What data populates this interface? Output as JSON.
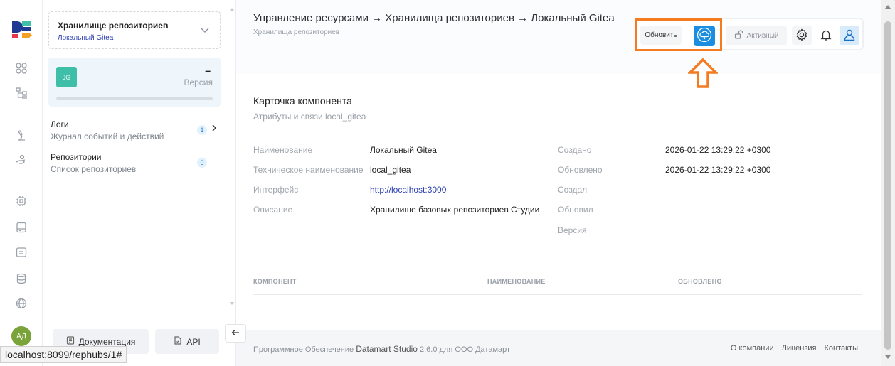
{
  "rail": {
    "avatar_initials": "АД"
  },
  "sidebar": {
    "repo_title": "Хранилище репозиториев",
    "repo_subtitle": "Локальный Gitea",
    "version_card": {
      "initials": "JG",
      "value": "–",
      "label": "Версия"
    },
    "nav": [
      {
        "title": "Логи",
        "subtitle": "Журнал событий и действий",
        "count": "1"
      },
      {
        "title": "Репозитории",
        "subtitle": "Список репозиториев",
        "count": "0"
      }
    ],
    "docs_label": "Документация",
    "api_label": "API"
  },
  "status_bar": {
    "url": "localhost:8099/rephubs/1#"
  },
  "header": {
    "breadcrumb": "Управление ресурсами → Хранилища репозиториев → Локальный Gitea",
    "subtitle": "Хранилища репозиториев",
    "refresh_label": "Обновить",
    "active_label": "Активный"
  },
  "card": {
    "title": "Карточка компонента",
    "subtitle": "Атрибуты и связи local_gitea",
    "left": [
      {
        "key": "Наименование",
        "value": "Локальный Gitea"
      },
      {
        "key": "Техническое наименование",
        "value": "local_gitea"
      },
      {
        "key": "Интерфейс",
        "value": "http://localhost:3000"
      },
      {
        "key": "Описание",
        "value": "Хранилище базовых репозиториев Студии"
      }
    ],
    "right": [
      {
        "key": "Создано",
        "value": "2026-01-22 13:29:22 +0300"
      },
      {
        "key": "Обновлено",
        "value": "2026-01-22 13:29:22 +0300"
      },
      {
        "key": "Создал",
        "value": ""
      },
      {
        "key": "Обновил",
        "value": ""
      },
      {
        "key": "Версия",
        "value": ""
      }
    ]
  },
  "table": {
    "columns": [
      "КОМПОНЕНТ",
      "НАИМЕНОВАНИЕ",
      "ОБНОВЛЕНО"
    ]
  },
  "footer": {
    "prefix": "Программное Обеспечение",
    "brand": "Datamart Studio",
    "suffix": "2.6.0 для ООО Датамарт",
    "links": [
      "О компании",
      "Лицензия",
      "Контакты"
    ]
  },
  "colors": {
    "accent": "#1a8de0",
    "highlight": "#f47b20",
    "badge_teal": "#3fbfa8",
    "avatar_green": "#7aa33a"
  }
}
